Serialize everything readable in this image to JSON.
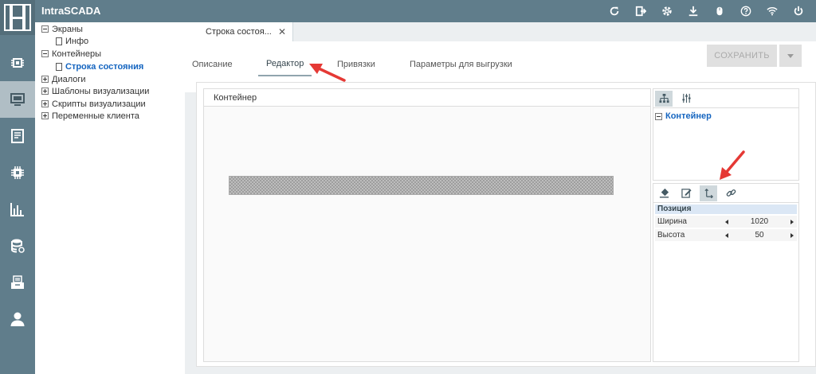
{
  "app": {
    "title": "IntraSCADA"
  },
  "topbar": {
    "icons": [
      "refresh-icon",
      "exit-icon",
      "gear-icon",
      "download-icon",
      "mouse-icon",
      "help-icon",
      "wifi-icon",
      "power-icon"
    ]
  },
  "rail": {
    "icons": [
      "chip-icon",
      "monitor-icon",
      "document-icon",
      "processor-icon",
      "bar-chart-icon",
      "database-icon",
      "archive-icon",
      "user-icon"
    ],
    "active_index": 1
  },
  "tree": {
    "items": [
      {
        "label": "Экраны",
        "toggle": "minus"
      },
      {
        "label": "Инфо"
      },
      {
        "label": "Контейнеры",
        "toggle": "minus"
      },
      {
        "label": "Строка состояния",
        "selected": true
      },
      {
        "label": "Диалоги",
        "toggle": "plus"
      },
      {
        "label": "Шаблоны визуализации",
        "toggle": "plus"
      },
      {
        "label": "Скрипты визуализации",
        "toggle": "plus"
      },
      {
        "label": "Переменные клиента",
        "toggle": "plus"
      }
    ]
  },
  "doc_tab": {
    "label": "Строка состоя...",
    "close": "✕"
  },
  "sub_tabs": [
    {
      "label": "Описание"
    },
    {
      "label": "Редактор",
      "active": true
    },
    {
      "label": "Привязки"
    },
    {
      "label": "Параметры для выгрузки"
    }
  ],
  "save_button": {
    "label": "СОХРАНИТЬ"
  },
  "editor": {
    "header": "Контейнер"
  },
  "structure": {
    "root_label": "Контейнер"
  },
  "properties": {
    "section": "Позиция",
    "rows": [
      {
        "name": "Ширина",
        "value": "1020"
      },
      {
        "name": "Высота",
        "value": "50"
      }
    ]
  },
  "colors": {
    "topbar": "#607d8b",
    "rail": "#607d8b",
    "rail_active": "#b0bec5",
    "selected_text": "#1565c0",
    "annotation_arrow": "#e53935"
  }
}
